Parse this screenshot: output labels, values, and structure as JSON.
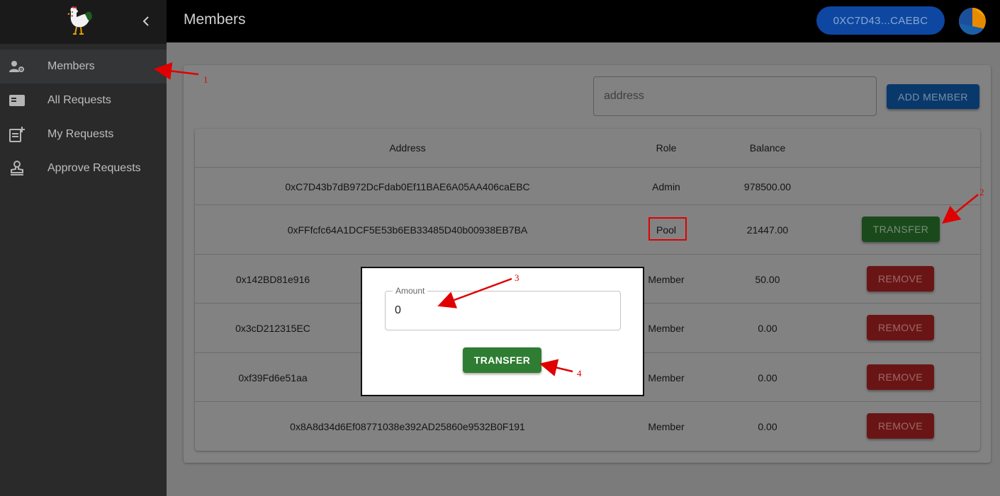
{
  "sidebar": {
    "collapse_icon": "chevron-left-icon",
    "logo_icon": "rooster-logo",
    "items": [
      {
        "label": "Members",
        "icon": "user-gear-icon",
        "active": true
      },
      {
        "label": "All Requests",
        "icon": "card-list-icon"
      },
      {
        "label": "My Requests",
        "icon": "note-add-icon"
      },
      {
        "label": "Approve Requests",
        "icon": "stamp-icon"
      }
    ]
  },
  "topbar": {
    "title": "Members",
    "wallet": "0XC7D43...CAEBC",
    "avatar_icon": "identicon-avatar"
  },
  "toolbar": {
    "address_placeholder": "address",
    "add_member_label": "ADD MEMBER"
  },
  "table": {
    "headers": {
      "address": "Address",
      "role": "Role",
      "balance": "Balance"
    },
    "rows": [
      {
        "address": "0xC7D43b7dB972DcFdab0Ef11BAE6A05AA406caEBC",
        "role": "Admin",
        "balance": "978500.00",
        "action": ""
      },
      {
        "address": "0xFFfcfc64A1DCF5E53b6EB33485D40b00938EB7BA",
        "role": "Pool",
        "balance": "21447.00",
        "action": "TRANSFER"
      },
      {
        "address": "0x142BD81e916",
        "role": "Member",
        "balance": "50.00",
        "action": "REMOVE"
      },
      {
        "address": "0x3cD212315EC",
        "role": "Member",
        "balance": "0.00",
        "action": "REMOVE"
      },
      {
        "address": "0xf39Fd6e51aa",
        "role": "Member",
        "balance": "0.00",
        "action": "REMOVE"
      },
      {
        "address": "0x8A8d34d6Ef08771038e392AD25860e9532B0F191",
        "role": "Member",
        "balance": "0.00",
        "action": "REMOVE"
      }
    ]
  },
  "modal": {
    "amount_label": "Amount",
    "amount_value": "0",
    "transfer_label": "TRANSFER"
  },
  "annotations": {
    "n1": "1",
    "n2": "2",
    "n3": "3",
    "n4": "4",
    "color": "#e00000"
  },
  "colors": {
    "primary": "#0d47a1",
    "success": "#2e7d32",
    "danger": "#c62828",
    "sidebar": "#2a2a2a"
  }
}
